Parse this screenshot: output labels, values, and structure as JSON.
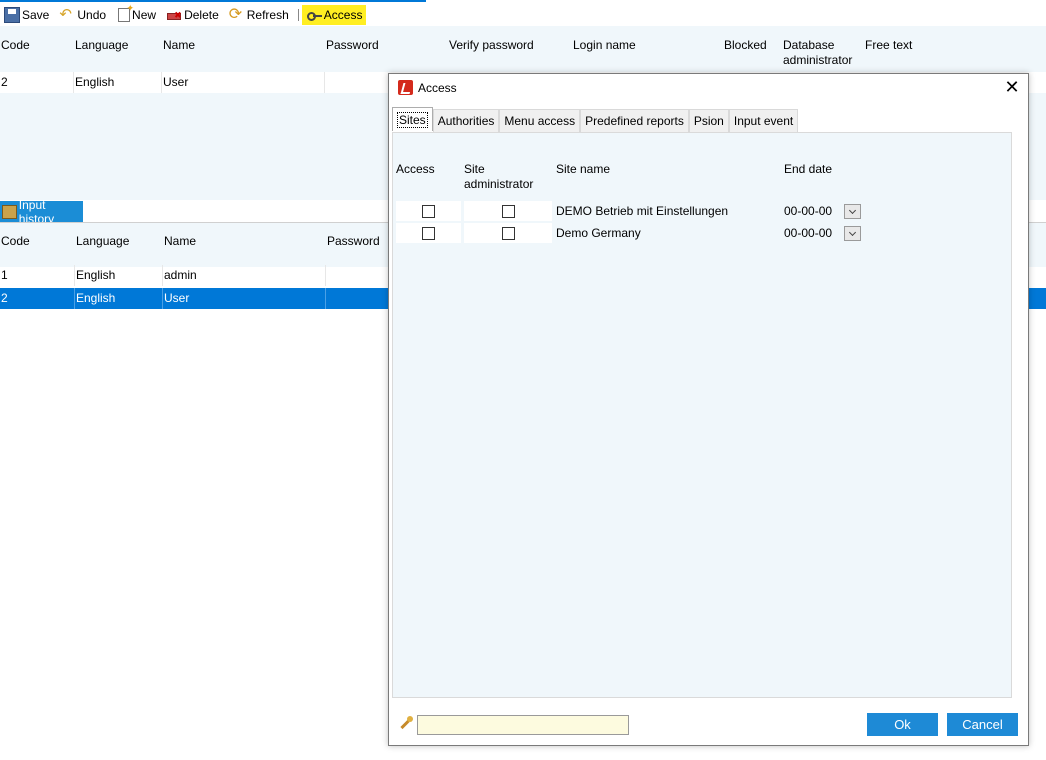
{
  "toolbar": {
    "save": "Save",
    "undo": "Undo",
    "new": "New",
    "delete": "Delete",
    "refresh": "Refresh",
    "access": "Access"
  },
  "upper_grid": {
    "columns": [
      "Code",
      "Language",
      "Name",
      "Password",
      "Verify password",
      "Login name",
      "Blocked",
      "Database administrator",
      "Free text"
    ],
    "rows": [
      {
        "code": "2",
        "language": "English",
        "name": "User"
      }
    ]
  },
  "history_tab": {
    "label": "Input history"
  },
  "lower_grid": {
    "columns": [
      "Code",
      "Language",
      "Name",
      "Password"
    ],
    "rows": [
      {
        "code": "1",
        "language": "English",
        "name": "admin"
      },
      {
        "code": "2",
        "language": "English",
        "name": "User"
      }
    ]
  },
  "dialog": {
    "title": "Access",
    "tabs": [
      "Sites",
      "Authorities",
      "Menu access",
      "Predefined reports",
      "Psion",
      "Input event"
    ],
    "active_tab": "Sites",
    "headers": {
      "access": "Access",
      "site_admin": "Site administrator",
      "site_name": "Site name",
      "end_date": "End date"
    },
    "rows": [
      {
        "access": false,
        "site_admin": false,
        "site_name": "DEMO Betrieb mit Einstellungen",
        "end_date": "00-00-00"
      },
      {
        "access": false,
        "site_admin": false,
        "site_name": "Demo Germany",
        "end_date": "00-00-00"
      }
    ],
    "footer_input_value": "",
    "ok": "Ok",
    "cancel": "Cancel"
  },
  "colors": {
    "accent": "#1e8ad6",
    "selection": "#0078d7",
    "panel_bg": "#f0f7fb",
    "highlight": "#ffee22"
  }
}
